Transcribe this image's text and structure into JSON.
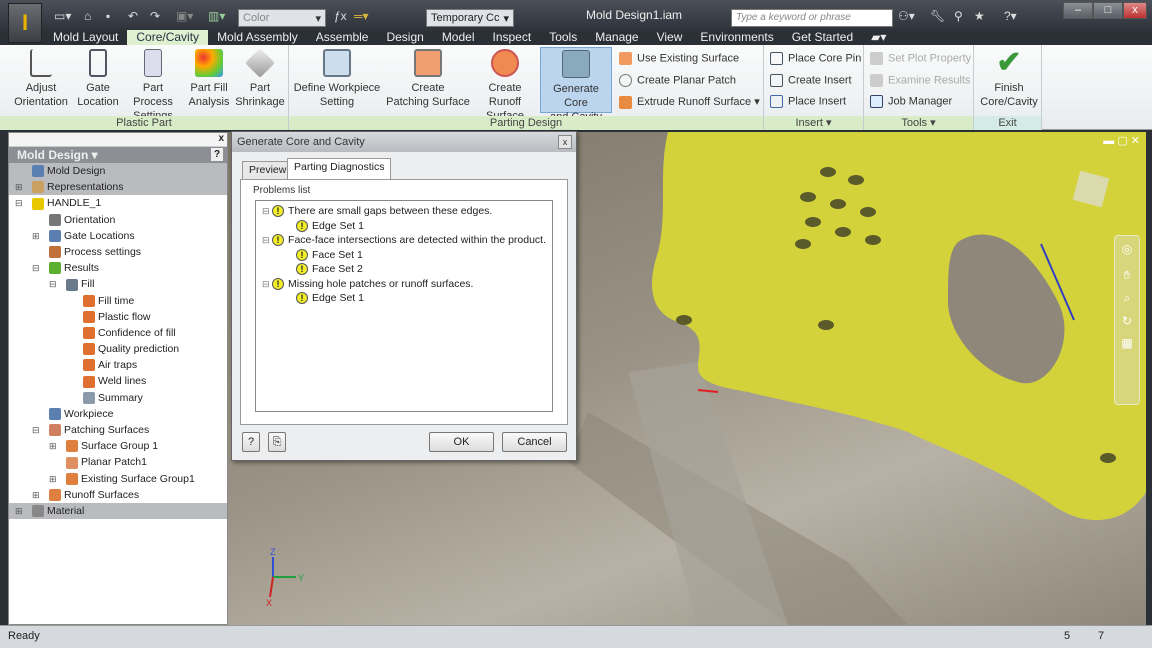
{
  "titlebar": {
    "app_icon": "I",
    "document_title": "Mold Design1.iam",
    "color_combo": "Color",
    "view_combo": "Temporary Cc",
    "search_placeholder": "Type a keyword or phrase",
    "icons": [
      "new-icon",
      "open-icon",
      "save-icon",
      "undo-icon",
      "redo-icon",
      "binoculars-icon",
      "wrench-icon",
      "satellite-icon",
      "star-icon",
      "help-icon"
    ]
  },
  "window_controls": {
    "minimize": "–",
    "maximize": "□",
    "close": "x"
  },
  "tabs": [
    {
      "label": "Mold Layout"
    },
    {
      "label": "Core/Cavity",
      "active": true
    },
    {
      "label": "Mold Assembly"
    },
    {
      "label": "Assemble"
    },
    {
      "label": "Design"
    },
    {
      "label": "Model"
    },
    {
      "label": "Inspect"
    },
    {
      "label": "Tools"
    },
    {
      "label": "Manage"
    },
    {
      "label": "View"
    },
    {
      "label": "Environments"
    },
    {
      "label": "Get Started"
    }
  ],
  "ribbon": {
    "plastic_part": {
      "label": "Plastic Part",
      "buttons": [
        {
          "l1": "Adjust",
          "l2": "Orientation"
        },
        {
          "l1": "Gate",
          "l2": "Location"
        },
        {
          "l1": "Part Process",
          "l2": "Settings"
        },
        {
          "l1": "Part Fill",
          "l2": "Analysis"
        },
        {
          "l1": "Part",
          "l2": "Shrinkage"
        }
      ]
    },
    "parting_design": {
      "label": "Parting Design",
      "buttons": [
        {
          "l1": "Define Workpiece",
          "l2": "Setting"
        },
        {
          "l1": "Create",
          "l2": "Patching Surface"
        },
        {
          "l1": "Create Runoff",
          "l2": "Surface"
        },
        {
          "l1": "Generate Core",
          "l2": "and Cavity"
        }
      ],
      "small": [
        "Use Existing Surface",
        "Create Planar Patch",
        "Extrude Runoff Surface"
      ]
    },
    "insert": {
      "label": "Insert ▾",
      "small": [
        "Place Core Pin",
        "Create Insert",
        "Place Insert"
      ]
    },
    "tools": {
      "label": "Tools ▾",
      "small": [
        "Set Plot Property",
        "Examine Results",
        "Job Manager"
      ]
    },
    "exit": {
      "label": "Exit",
      "l1": "Finish",
      "l2": "Core/Cavity"
    }
  },
  "browser": {
    "title": "Mold Design ▾",
    "help": "?",
    "close": "x",
    "items": [
      {
        "label": "Mold Design",
        "exp": "",
        "indent": 0,
        "color": "#5a7fb0",
        "gray": true
      },
      {
        "label": "Representations",
        "exp": "+",
        "indent": 0,
        "color": "#c9a060",
        "gray": true
      },
      {
        "label": "HANDLE_1",
        "exp": "−",
        "indent": 0,
        "color": "#e8c800"
      },
      {
        "label": "Orientation",
        "exp": "",
        "indent": 1,
        "color": "#777"
      },
      {
        "label": "Gate Locations",
        "exp": "+",
        "indent": 1,
        "color": "#5a7fb0"
      },
      {
        "label": "Process settings",
        "exp": "",
        "indent": 1,
        "color": "#c0703a"
      },
      {
        "label": "Results",
        "exp": "−",
        "indent": 1,
        "color": "#5cb030"
      },
      {
        "label": "Fill",
        "exp": "−",
        "indent": 2,
        "color": "#6a7a8a"
      },
      {
        "label": "Fill time",
        "exp": "",
        "indent": 3,
        "color": "#e07030"
      },
      {
        "label": "Plastic flow",
        "exp": "",
        "indent": 3,
        "color": "#e07030"
      },
      {
        "label": "Confidence of fill",
        "exp": "",
        "indent": 3,
        "color": "#e07030"
      },
      {
        "label": "Quality prediction",
        "exp": "",
        "indent": 3,
        "color": "#e07030"
      },
      {
        "label": "Air traps",
        "exp": "",
        "indent": 3,
        "color": "#e07030"
      },
      {
        "label": "Weld lines",
        "exp": "",
        "indent": 3,
        "color": "#e07030"
      },
      {
        "label": "Summary",
        "exp": "",
        "indent": 3,
        "color": "#8a9aaa"
      },
      {
        "label": "Workpiece",
        "exp": "",
        "indent": 1,
        "color": "#5a7fb0"
      },
      {
        "label": "Patching Surfaces",
        "exp": "−",
        "indent": 1,
        "color": "#d08060"
      },
      {
        "label": "Surface Group 1",
        "exp": "+",
        "indent": 2,
        "color": "#e08040"
      },
      {
        "label": "Planar Patch1",
        "exp": "",
        "indent": 2,
        "color": "#e09060"
      },
      {
        "label": "Existing Surface Group1",
        "exp": "+",
        "indent": 2,
        "color": "#e08040"
      },
      {
        "label": "Runoff Surfaces",
        "exp": "+",
        "indent": 1,
        "color": "#e08040"
      },
      {
        "label": "Material",
        "exp": "+",
        "indent": 0,
        "color": "#888",
        "gray": true
      }
    ]
  },
  "dialog": {
    "title": "Generate Core and Cavity",
    "close": "x",
    "tabs": [
      "Preview",
      "Parting Diagnostics"
    ],
    "active_tab": "Parting Diagnostics",
    "group_label": "Problems list",
    "problems": [
      {
        "text": "There are small gaps between these edges.",
        "children": [
          "Edge Set 1"
        ]
      },
      {
        "text": "Face-face intersections are detected within the product.",
        "children": [
          "Face Set 1",
          "Face Set 2"
        ]
      },
      {
        "text": "Missing hole patches or runoff surfaces.",
        "children": [
          "Edge Set 1"
        ]
      }
    ],
    "ok": "OK",
    "cancel": "Cancel",
    "help": "?"
  },
  "viewport": {
    "part_color": "#d4d23a",
    "axis_labels": {
      "z": "Z",
      "x": "X",
      "y": "Y"
    }
  },
  "status": {
    "text": "Ready",
    "count1": "5",
    "count2": "7"
  }
}
